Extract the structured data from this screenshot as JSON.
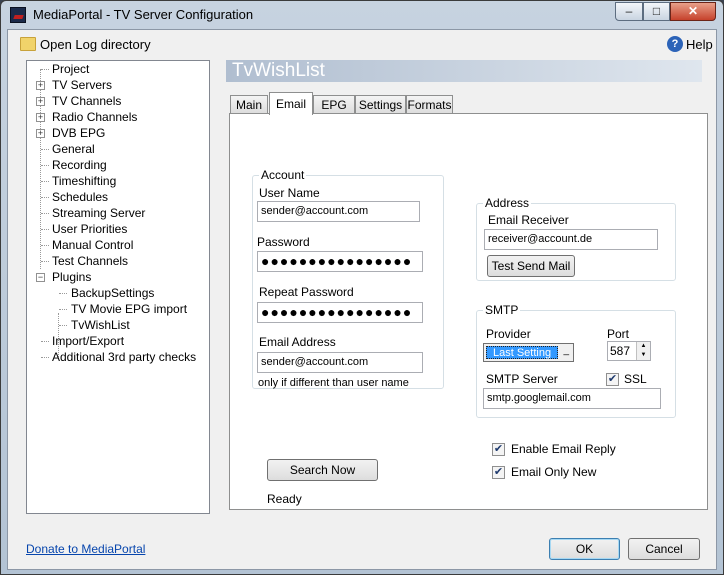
{
  "window": {
    "title": "MediaPortal - TV Server Configuration",
    "min_glyph": "–",
    "max_glyph": "□",
    "close_glyph": "✕"
  },
  "toolbar": {
    "open_log": "Open Log directory",
    "help": "Help",
    "help_glyph": "?"
  },
  "tree": {
    "expand_glyph": "+",
    "collapse_glyph": "−",
    "items": [
      {
        "label": "Project"
      },
      {
        "label": "TV Servers"
      },
      {
        "label": "TV Channels"
      },
      {
        "label": "Radio Channels"
      },
      {
        "label": "DVB EPG"
      },
      {
        "label": "General"
      },
      {
        "label": "Recording"
      },
      {
        "label": "Timeshifting"
      },
      {
        "label": "Schedules"
      },
      {
        "label": "Streaming Server"
      },
      {
        "label": "User Priorities"
      },
      {
        "label": "Manual Control"
      },
      {
        "label": "Test Channels"
      },
      {
        "label": "Plugins"
      },
      {
        "label": "BackupSettings"
      },
      {
        "label": "TV Movie EPG import"
      },
      {
        "label": "TvWishList"
      },
      {
        "label": "Import/Export"
      },
      {
        "label": "Additional 3rd party checks"
      }
    ]
  },
  "section": {
    "title": "TvWishList"
  },
  "tabs": [
    {
      "label": "Main"
    },
    {
      "label": "Email"
    },
    {
      "label": "EPG"
    },
    {
      "label": "Settings"
    },
    {
      "label": "Formats"
    }
  ],
  "account": {
    "title": "Account",
    "user_name_label": "User Name",
    "user_name": "sender@account.com",
    "password_label": "Password",
    "password": "●●●●●●●●●●●●●●●●",
    "repeat_label": "Repeat Password",
    "repeat_password": "●●●●●●●●●●●●●●●●",
    "email_label": "Email Address",
    "email": "sender@account.com",
    "email_hint": "only if different than user name"
  },
  "address": {
    "title": "Address",
    "receiver_label": "Email Receiver",
    "receiver": "receiver@account.de",
    "test_button": "Test Send Mail"
  },
  "smtp": {
    "title": "SMTP",
    "provider_label": "Provider",
    "provider_value": "Last Setting",
    "provider_arrow": "_",
    "port_label": "Port",
    "port": "587",
    "spin_up": "▲",
    "spin_down": "▼",
    "server_label": "SMTP Server",
    "ssl_label": "SSL",
    "ssl_checked": true,
    "server": "smtp.googlemail.com"
  },
  "options": {
    "enable_reply": "Enable Email Reply",
    "only_new": "Email Only New",
    "check_glyph": "✔"
  },
  "actions": {
    "search_now": "Search Now",
    "status": "Ready"
  },
  "footer": {
    "donate": "Donate to MediaPortal",
    "ok": "OK",
    "cancel": "Cancel"
  }
}
